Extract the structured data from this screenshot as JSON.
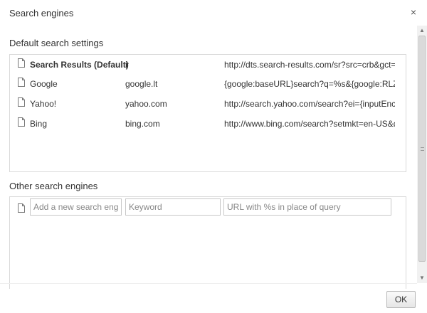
{
  "dialog": {
    "title": "Search engines",
    "close_label": "×",
    "ok_label": "OK"
  },
  "default_section": {
    "title": "Default search settings",
    "engines": [
      {
        "name": "Search Results (Default)",
        "keyword": "r",
        "url": "http://dts.search-results.com/sr?src=crb&gct=ds...",
        "bold": true
      },
      {
        "name": "Google",
        "keyword": "google.lt",
        "url": "{google:baseURL}search?q=%s&{google:RLZ}{go...",
        "bold": false
      },
      {
        "name": "Yahoo!",
        "keyword": "yahoo.com",
        "url": "http://search.yahoo.com/search?ei={inputEncodi...",
        "bold": false
      },
      {
        "name": "Bing",
        "keyword": "bing.com",
        "url": "http://www.bing.com/search?setmkt=en-US&q=...",
        "bold": false
      }
    ]
  },
  "other_section": {
    "title": "Other search engines",
    "add_name_placeholder": "Add a new search engine",
    "add_keyword_placeholder": "Keyword",
    "add_url_placeholder": "URL with %s in place of query"
  },
  "icons": {
    "document": "document-icon",
    "close": "close-icon"
  }
}
